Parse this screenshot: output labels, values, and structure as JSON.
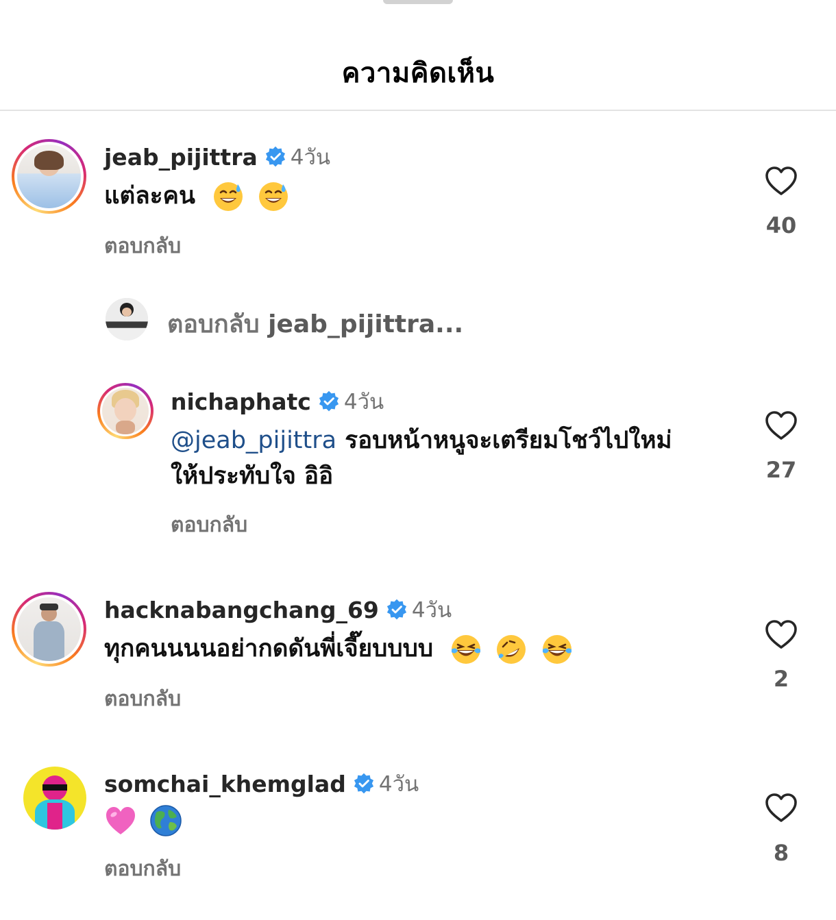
{
  "header": {
    "title": "ความคิดเห็น"
  },
  "comments": [
    {
      "username": "jeab_pijittra",
      "time": "4วัน",
      "text": "แต่ละคน",
      "emojis": [
        "grinning-sweat-emoji",
        "grinning-sweat-emoji"
      ],
      "reply_label": "ตอบกลับ",
      "likes": "40",
      "view_replies": {
        "label": "ตอบกลับ",
        "target": "jeab_pijittra..."
      }
    },
    {
      "username": "nichaphatc",
      "time": "4วัน",
      "mention": "@jeab_pijittra",
      "text_line1": "รอบหน้าหนูจะเตรียมโชว์ไปใหม่",
      "text_line2": "ให้ประทับใจ อิอิ",
      "reply_label": "ตอบกลับ",
      "likes": "27"
    },
    {
      "username": "hacknabangchang_69",
      "time": "4วัน",
      "text": "ทุกคนนนนอย่ากดดันพี่เจี๊ยบบบบ",
      "emojis": [
        "tears-of-joy-emoji",
        "rofl-emoji",
        "tears-of-joy-emoji"
      ],
      "reply_label": "ตอบกลับ",
      "likes": "2"
    },
    {
      "username": "somchai_khemglad",
      "time": "4วัน",
      "emojis": [
        "pink-heart-emoji",
        "globe-emoji"
      ],
      "reply_label": "ตอบกลับ",
      "likes": "8"
    }
  ],
  "colors": {
    "verified": "#3897f0",
    "mention": "#1f4f8a",
    "secondary_text": "#737373"
  }
}
